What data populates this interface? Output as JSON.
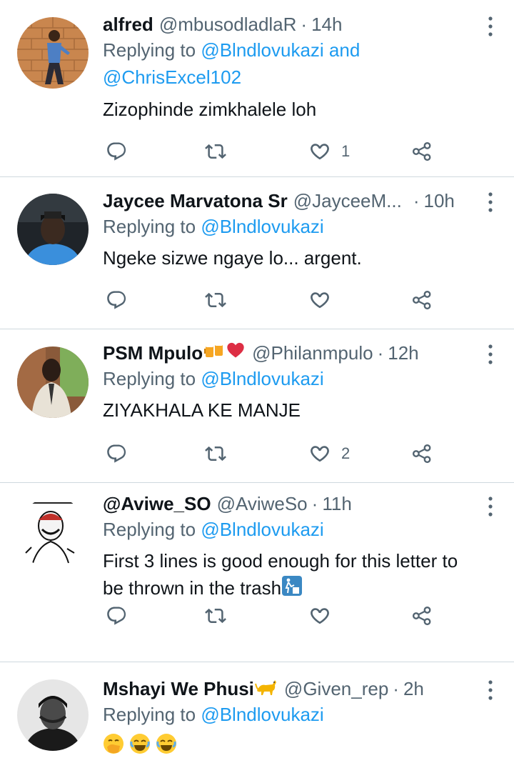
{
  "tweets": [
    {
      "name": "alfred",
      "handle": "@mbusodladlaR",
      "time": "14h",
      "reply_label": "Replying to",
      "reply_to_1": "@Blndlovukazi and",
      "reply_to_2": "@ChrisExcel102",
      "text": "Zizophinde zimkhalele loh",
      "likes": "1",
      "avatar_icon": "user-photo-brick-wall"
    },
    {
      "name": "Jaycee Marvatona Sr",
      "handle": "@JayceeM...",
      "time": "10h",
      "reply_label": "Replying to",
      "reply_to_1": "@Blndlovukazi",
      "text": "Ngeke sizwe ngaye lo... argent.",
      "likes": "",
      "avatar_icon": "user-photo-car"
    },
    {
      "name": "PSM Mpulo",
      "handle": "@Philanmpulo",
      "time": "12h",
      "reply_label": "Replying to",
      "reply_to_1": "@Blndlovukazi",
      "text": "ZIYAKHALA KE MANJE",
      "likes": "2",
      "name_emoji": [
        "beer-mugs-emoji",
        "red-heart-emoji"
      ],
      "avatar_icon": "user-photo-outdoor"
    },
    {
      "name": "@Aviwe_SO",
      "handle": "@AviweSo",
      "time": "11h",
      "reply_label": "Replying to",
      "reply_to_1": "@Blndlovukazi",
      "text_1": "First 3 lines is good enough for this letter to",
      "text_2": "be thrown in the trash",
      "text_emoji": "litter-bin-emoji",
      "likes": "",
      "avatar_icon": "user-sketch-art"
    },
    {
      "name": "Mshayi We Phusi",
      "handle": "@Given_rep",
      "time": "2h",
      "reply_label": "Replying to",
      "reply_to_1": "@Blndlovukazi",
      "name_emoji": "cat-emoji",
      "text_emojis": [
        "hand-over-mouth-emoji",
        "tears-of-joy-emoji",
        "tears-of-joy-emoji"
      ],
      "avatar_icon": "user-photo-bw"
    }
  ],
  "colors": {
    "link": "#1d9bf0",
    "muted": "#536471",
    "text": "#0f1419",
    "divider": "#cfd9de"
  }
}
